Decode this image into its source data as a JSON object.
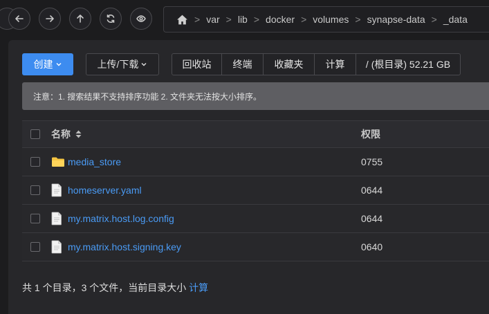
{
  "nav": {
    "buttons": [
      "back-icon",
      "forward-icon",
      "up-icon",
      "refresh-icon",
      "eye-icon"
    ]
  },
  "breadcrumb": {
    "separator": ">",
    "segments": [
      "var",
      "lib",
      "docker",
      "volumes",
      "synapse-data",
      "_data"
    ]
  },
  "toolbar": {
    "create_label": "创建",
    "upload_label": "上传/下载",
    "recycle_label": "回收站",
    "terminal_label": "终端",
    "favorites_label": "收藏夹",
    "calculate_label": "计算",
    "disk_label": "/ (根目录) 52.21 GB"
  },
  "notice": {
    "text": "注意：1. 搜索结果不支持排序功能 2. 文件夹无法按大小排序。"
  },
  "table": {
    "headers": {
      "name": "名称",
      "permission": "权限"
    },
    "rows": [
      {
        "name": "media_store",
        "type": "folder",
        "permission": "0755"
      },
      {
        "name": "homeserver.yaml",
        "type": "file",
        "permission": "0644"
      },
      {
        "name": "my.matrix.host.log.config",
        "type": "file",
        "permission": "0644"
      },
      {
        "name": "my.matrix.host.signing.key",
        "type": "file",
        "permission": "0640"
      }
    ]
  },
  "footer": {
    "summary": "共 1 个目录，3 个文件，当前目录大小",
    "calc_link": "计算"
  },
  "colors": {
    "accent": "#3d8cf0",
    "link": "#4a9bf5",
    "folder": "#f5c542",
    "background": "#1c1c1e",
    "panel": "#27272a"
  }
}
